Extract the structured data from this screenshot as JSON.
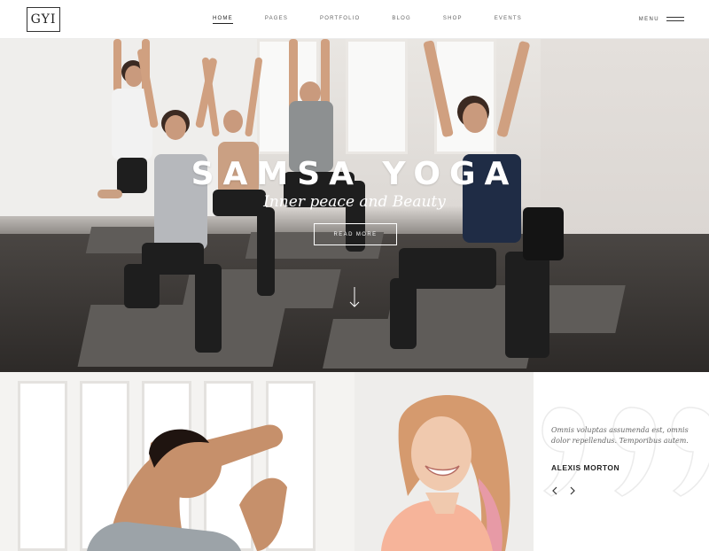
{
  "header": {
    "logo_text": "GYI",
    "nav": [
      {
        "label": "HOME",
        "active": true
      },
      {
        "label": "PAGES",
        "active": false
      },
      {
        "label": "PORTFOLIO",
        "active": false
      },
      {
        "label": "BLOG",
        "active": false
      },
      {
        "label": "SHOP",
        "active": false
      },
      {
        "label": "EVENTS",
        "active": false
      }
    ],
    "menu_label": "MENU"
  },
  "hero": {
    "title": "SAMSA YOGA",
    "subtitle": "Inner peace and Beauty",
    "button_label": "READ MORE",
    "icons": [
      "scroll-down-arrow-icon"
    ]
  },
  "testimonial": {
    "quote": "Omnis voluptas assumenda est, omnis dolor repellendus. Temporibus autem.",
    "author": "ALEXIS MORTON",
    "icons": [
      "quote-mark-icon",
      "chevron-left-icon",
      "chevron-right-icon"
    ]
  },
  "colors": {
    "text_dark": "#222222",
    "nav_gray": "#666666",
    "hero_text": "#ffffff"
  }
}
